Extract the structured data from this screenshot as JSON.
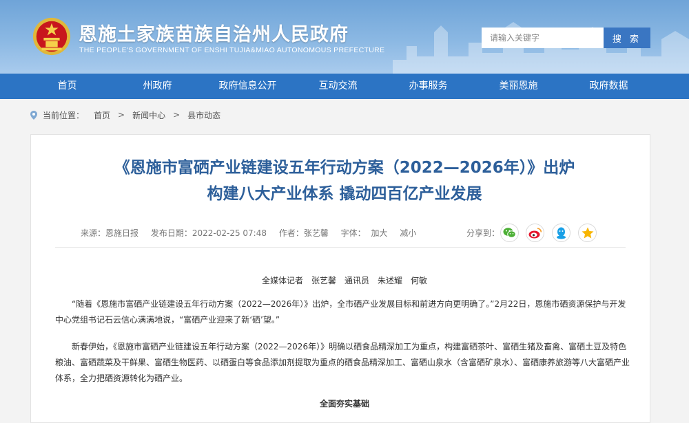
{
  "header": {
    "title": "恩施土家族苗族自治州人民政府",
    "subtitle": "THE PEOPLE'S GOVERNMENT OF ENSHI TUJIA&MIAO AUTONOMOUS PREFECTURE",
    "search_placeholder": "请输入关键字",
    "search_button": "搜 索"
  },
  "nav": [
    {
      "label": "首页"
    },
    {
      "label": "州政府"
    },
    {
      "label": "政府信息公开"
    },
    {
      "label": "互动交流"
    },
    {
      "label": "办事服务"
    },
    {
      "label": "美丽恩施"
    },
    {
      "label": "政府数据"
    }
  ],
  "breadcrumb": {
    "prefix": "当前位置：",
    "items": [
      "首页",
      "新闻中心",
      "县市动态"
    ],
    "separator": ">"
  },
  "article": {
    "title_line1": "《恩施市富硒产业链建设五年行动方案（2022—2026年）》出炉",
    "title_line2": "构建八大产业体系 撬动四百亿产业发展",
    "meta": {
      "source": "来源：恩施日报",
      "date": "发布日期：2022-02-25 07:48",
      "author": "作者：张艺馨",
      "font_label": "字体：",
      "font_large": "加大",
      "font_small": "减小",
      "share_label": "分享到："
    },
    "byline": "全媒体记者　张艺馨　通讯员　朱述耀　何敏",
    "paragraphs": [
      "“随着《恩施市富硒产业链建设五年行动方案（2022—2026年）》出炉，全市硒产业发展目标和前进方向更明确了。”2月22日，恩施市硒资源保护与开发中心党组书记石云信心满满地说，“富硒产业迎来了新‘硒’望。”",
      "新春伊始，《恩施市富硒产业链建设五年行动方案（2022—2026年）》明确以硒食品精深加工为重点，构建富硒茶叶、富硒生猪及畜禽、富硒土豆及特色粮油、富硒蔬菜及干鲜果、富硒生物医药、以硒蛋白等食品添加剂提取为重点的硒食品精深加工、富硒山泉水（含富硒矿泉水）、富硒康养旅游等八大富硒产业体系，全力把硒资源转化为硒产业。"
    ],
    "section_heading": "全面夯实基础"
  },
  "share_icons": [
    "wechat-icon",
    "weibo-icon",
    "qq-icon",
    "qzone-icon"
  ],
  "colors": {
    "nav_bg": "#2c74c4",
    "title": "#2d5f9a",
    "search_btn": "#3a76c2"
  }
}
